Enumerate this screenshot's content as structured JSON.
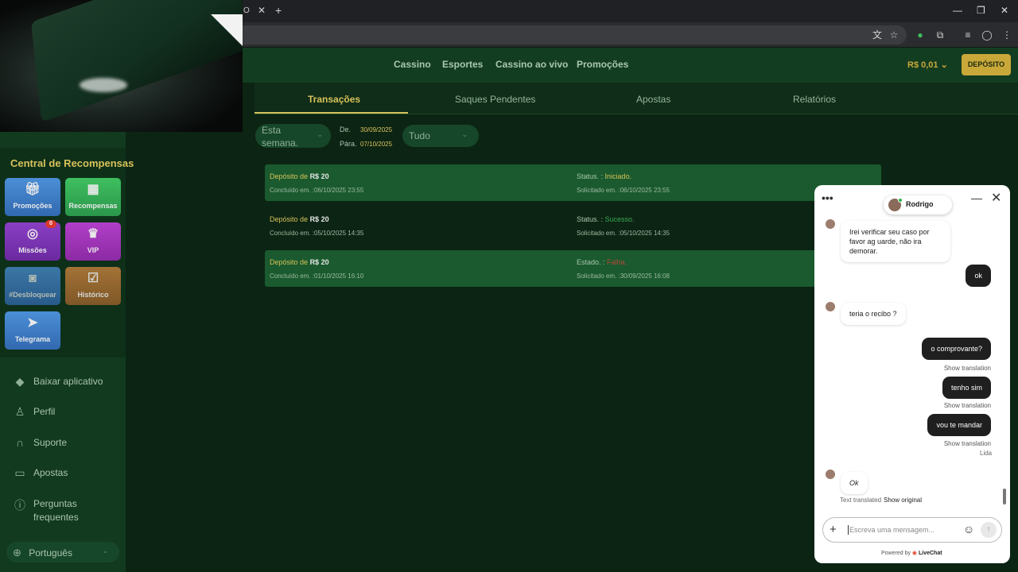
{
  "browser": {
    "tab_fragment": "O",
    "tab_close": "✕",
    "new_tab": "+",
    "window_controls": [
      "—",
      "❐",
      "✕"
    ]
  },
  "colors": {
    "accent_gold": "#d7c25a",
    "bg_green": "#0c2413",
    "status_success": "#3aa657",
    "status_fail": "#b84a3a"
  },
  "nav": {
    "links": [
      "Cassino",
      "Esportes",
      "Cassino ao vivo",
      "Promoções"
    ],
    "balance": "R$ 0,01",
    "deposit_label": "DEPÓSITO"
  },
  "sidebar": {
    "rewards_title": "Central de Recompensas",
    "tiles": [
      {
        "label": "Promoções",
        "icon": "gift-icon"
      },
      {
        "label": "Recompensas",
        "icon": "treasure-chest-icon"
      },
      {
        "label": "Missões",
        "icon": "target-icon",
        "badge": "0"
      },
      {
        "label": "VIP",
        "icon": "crown-icon"
      },
      {
        "label": "#Desbloquear",
        "icon": "camera-icon"
      },
      {
        "label": "Histórico",
        "icon": "calendar-check-icon"
      },
      {
        "label": "Telegrama",
        "icon": "paper-plane-icon"
      }
    ],
    "items": [
      {
        "label": "Baixar aplicativo",
        "icon": "android-icon"
      },
      {
        "label": "Perfil",
        "icon": "user-icon"
      },
      {
        "label": "Suporte",
        "icon": "headset-icon"
      },
      {
        "label": "Apostas",
        "icon": "book-icon"
      },
      {
        "label": "Perguntas frequentes",
        "icon": "info-icon"
      }
    ],
    "language": "Português"
  },
  "tabs": [
    "Transações",
    "Saques Pendentes",
    "Apostas",
    "Relatórios"
  ],
  "filters": {
    "period": "Esta semana.",
    "from_label": "De.",
    "from_value": "30/09/2025",
    "to_label": "Pára.",
    "to_value": "07/10/2025",
    "type": "Tudo"
  },
  "transactions": [
    {
      "title_prefix": "Depósito de",
      "amount": "R$ 20",
      "completed": "Concluído em. :06/10/2025 23:55",
      "status_label": "Status. :",
      "status": "Iniciado.",
      "requested": "Solicitado em. :06/10/2025 23:55"
    },
    {
      "title_prefix": "Depósito de",
      "amount": "R$ 20",
      "completed": "Concluído em. :05/10/2025 14:35",
      "status_label": "Status. :",
      "status": "Sucesso.",
      "requested": "Solicitado em. :05/10/2025 14:35"
    },
    {
      "title_prefix": "Depósito de",
      "amount": "R$ 20",
      "completed": "Concluído em. :01/10/2025 16:10",
      "status_label": "Estado. :",
      "status": "Falha.",
      "requested": "Solicitado em. :30/09/2025 16:08"
    }
  ],
  "chat": {
    "agent_name": "Rodrigo",
    "messages": [
      {
        "from": "agent",
        "text": "Irei verificar seu caso por favor ag uarde, não ira demorar."
      },
      {
        "from": "user",
        "text": "ok"
      },
      {
        "from": "agent",
        "text": "teria o recibo ?"
      },
      {
        "from": "user",
        "text": "o comprovante?",
        "note": "Show translation"
      },
      {
        "from": "user",
        "text": "tenho sim",
        "note": "Show translation"
      },
      {
        "from": "user",
        "text": "vou te mandar",
        "note": "Show translation"
      },
      {
        "from": "agent",
        "text": "Ok"
      }
    ],
    "read_receipt": "Lida",
    "translated_note": "Text translated",
    "show_original": "Show original",
    "input_placeholder": "Escreva uma mensagem...",
    "powered_by": "Powered by",
    "brand": "LiveChat"
  }
}
